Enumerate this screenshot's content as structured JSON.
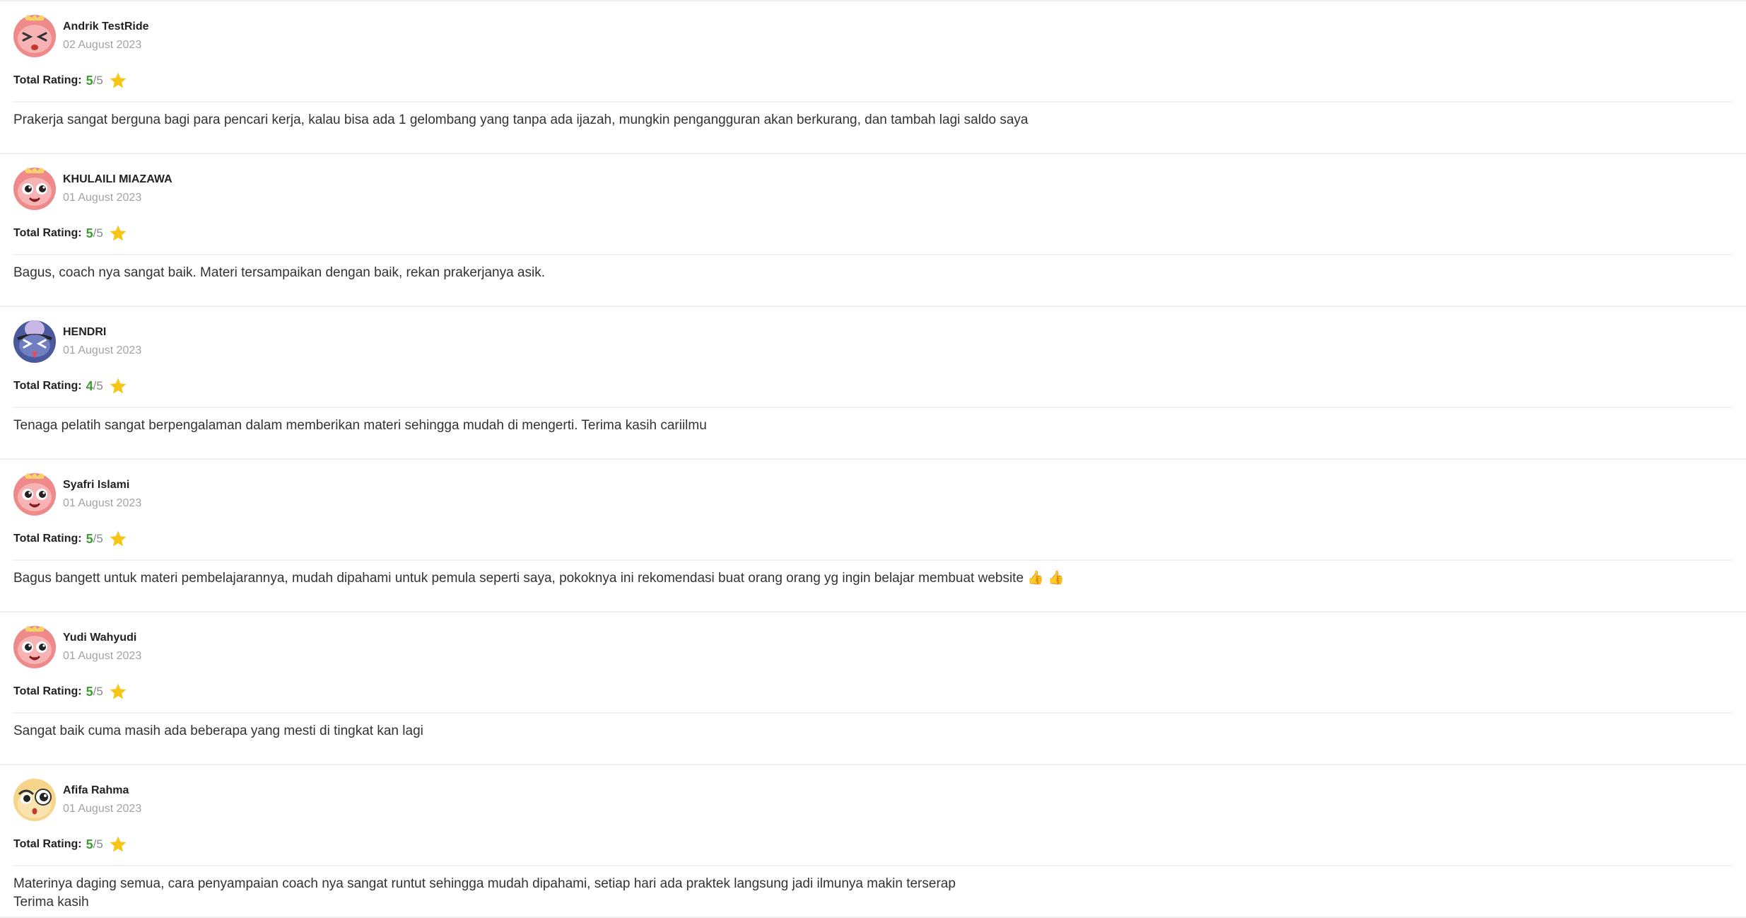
{
  "rating_label": "Total Rating:",
  "reviews": [
    {
      "name": "Andrik TestRide",
      "date": "02 August 2023",
      "rating": "5",
      "rating_max": "/5",
      "comment": "Prakerja sangat berguna bagi para pencari kerja, kalau bisa ada 1 gelombang yang tanpa ada ijazah, mungkin pengangguran akan berkurang, dan tambah lagi saldo saya",
      "avatar": "pink-squint-face-icon"
    },
    {
      "name": "KHULAILI MIAZAWA",
      "date": "01 August 2023",
      "rating": "5",
      "rating_max": "/5",
      "comment": "Bagus, coach nya sangat baik. Materi tersampaikan dengan baik, rekan prakerjanya asik.",
      "avatar": "pink-big-eyes-face-icon"
    },
    {
      "name": "HENDRI",
      "date": "01 August 2023",
      "rating": "4",
      "rating_max": "/5",
      "comment": "Tenaga pelatih sangat berpengalaman dalam memberikan materi sehingga mudah di mengerti. Terima kasih cariilmu",
      "avatar": "blue-squint-face-icon"
    },
    {
      "name": "Syafri Islami",
      "date": "01 August 2023",
      "rating": "5",
      "rating_max": "/5",
      "comment": "Bagus bangett untuk materi pembelajarannya, mudah dipahami untuk pemula seperti saya, pokoknya ini rekomendasi buat orang orang yg ingin belajar membuat website 👍 👍",
      "avatar": "pink-big-eyes-face-icon"
    },
    {
      "name": "Yudi Wahyudi",
      "date": "01 August 2023",
      "rating": "5",
      "rating_max": "/5",
      "comment": "Sangat baik cuma masih ada beberapa yang mesti di tingkat kan lagi",
      "avatar": "pink-big-eyes-face-icon"
    },
    {
      "name": "Afifa Rahma",
      "date": "01 August 2023",
      "rating": "5",
      "rating_max": "/5",
      "comment": "Materinya daging semua, cara penyampaian coach nya sangat runtut sehingga mudah dipahami, setiap hari ada praktek langsung jadi ilmunya makin terserap\nTerima kasih",
      "avatar": "yellow-owl-face-icon"
    }
  ],
  "colors": {
    "rating_value": "#3a9c2d",
    "star": "#f5c518",
    "date": "#a3a3a3",
    "divider": "#eeeeee"
  }
}
